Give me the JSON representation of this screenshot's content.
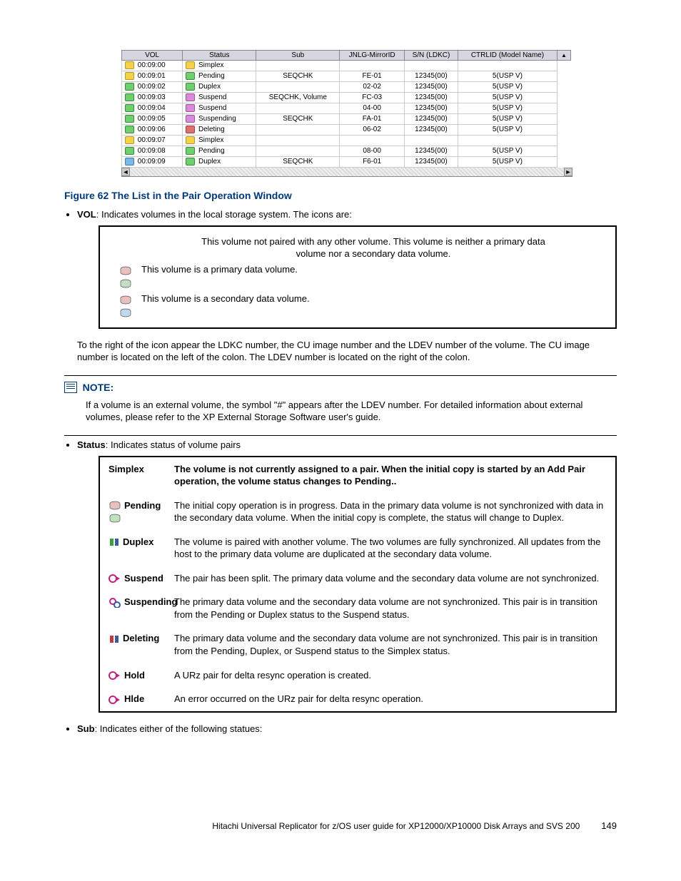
{
  "volTable": {
    "headers": [
      "VOL",
      "Status",
      "Sub",
      "JNLG-MirrorID",
      "S/N (LDKC)",
      "CTRLID (Model Name)"
    ],
    "rows": [
      {
        "iconA": "y",
        "vol": "00:09:00",
        "iconB": "y",
        "status": "Simplex",
        "sub": "",
        "mirror": "",
        "sn": "",
        "ctrl": ""
      },
      {
        "iconA": "y",
        "vol": "00:09:01",
        "iconB": "g",
        "status": "Pending",
        "sub": "SEQCHK",
        "mirror": "FE-01",
        "sn": "12345(00)",
        "ctrl": "5(USP V)"
      },
      {
        "iconA": "g",
        "vol": "00:09:02",
        "iconB": "g",
        "status": "Duplex",
        "sub": "",
        "mirror": "02-02",
        "sn": "12345(00)",
        "ctrl": "5(USP V)"
      },
      {
        "iconA": "g",
        "vol": "00:09:03",
        "iconB": "p",
        "status": "Suspend",
        "sub": "SEQCHK, Volume",
        "mirror": "FC-03",
        "sn": "12345(00)",
        "ctrl": "5(USP V)"
      },
      {
        "iconA": "g",
        "vol": "00:09:04",
        "iconB": "p",
        "status": "Suspend",
        "sub": "",
        "mirror": "04-00",
        "sn": "12345(00)",
        "ctrl": "5(USP V)"
      },
      {
        "iconA": "g",
        "vol": "00:09:05",
        "iconB": "p",
        "status": "Suspending",
        "sub": "SEQCHK",
        "mirror": "FA-01",
        "sn": "12345(00)",
        "ctrl": "5(USP V)"
      },
      {
        "iconA": "g",
        "vol": "00:09:06",
        "iconB": "r",
        "status": "Deleting",
        "sub": "",
        "mirror": "06-02",
        "sn": "12345(00)",
        "ctrl": "5(USP V)"
      },
      {
        "iconA": "y",
        "vol": "00:09:07",
        "iconB": "y",
        "status": "Simplex",
        "sub": "",
        "mirror": "",
        "sn": "",
        "ctrl": ""
      },
      {
        "iconA": "g",
        "vol": "00:09:08",
        "iconB": "g",
        "status": "Pending",
        "sub": "",
        "mirror": "08-00",
        "sn": "12345(00)",
        "ctrl": "5(USP V)"
      },
      {
        "iconA": "b",
        "vol": "00:09:09",
        "iconB": "g",
        "status": "Duplex",
        "sub": "SEQCHK",
        "mirror": "F6-01",
        "sn": "12345(00)",
        "ctrl": "5(USP V)"
      }
    ]
  },
  "figureCaption": "Figure 62 The List in the Pair Operation Window",
  "volBullet": {
    "label": "VOL",
    "text": ": Indicates volumes in the local storage system. The icons are:"
  },
  "iconDefs": [
    {
      "icon": "",
      "text": "This volume not paired with any other volume. This volume is neither a primary data volume nor a secondary data volume."
    },
    {
      "icon": "pri",
      "text": "This volume is a primary data volume."
    },
    {
      "icon": "sec",
      "text": "This volume is a secondary data volume."
    }
  ],
  "afterIconDefs": "To the right of the icon appear the LDKC number, the CU image number and the LDEV number of the volume. The CU image number is located on the left of the colon. The LDEV number is located on the right of the colon.",
  "noteHead": "NOTE:",
  "noteBody": "If a volume is an external volume, the symbol \"#\" appears after the LDEV number. For detailed information about external volumes, please refer to the XP External Storage Software user's guide.",
  "statusBullet": {
    "label": "Status",
    "text": ": Indicates status of volume pairs"
  },
  "statusDefs": [
    {
      "icon": "",
      "label": "Simplex",
      "desc": "The volume is not currently assigned to a pair. When the initial copy is started by an Add Pair operation, the volume status changes to Pending..",
      "head": true
    },
    {
      "icon": "pending",
      "label": "Pending",
      "desc": "The initial copy operation is in progress. Data in the primary data volume is not synchronized with data in the secondary data volume. When the initial copy is complete, the status will change to Duplex."
    },
    {
      "icon": "duplex",
      "label": "Duplex",
      "desc": "The volume is paired with another volume. The two volumes are fully synchronized. All updates from the host to the primary data volume are duplicated at the secondary data volume."
    },
    {
      "icon": "suspend",
      "label": "Suspend",
      "desc": "The pair has been split. The primary data volume and the secondary data volume are not synchronized."
    },
    {
      "icon": "suspending",
      "label": "Suspending",
      "desc": "The primary data volume and the secondary data volume are not synchronized. This pair is in transition from the Pending or Duplex status to the Suspend status."
    },
    {
      "icon": "deleting",
      "label": "Deleting",
      "desc": "The primary data volume and the secondary data volume are not synchronized. This pair is in transition from the Pending, Duplex, or Suspend status to the Simplex status."
    },
    {
      "icon": "hold",
      "label": "Hold",
      "desc": "A URz pair for delta resync operation is created."
    },
    {
      "icon": "hlde",
      "label": "Hlde",
      "desc": "An error occurred on the URz pair for delta resync operation."
    }
  ],
  "subBullet": {
    "label": "Sub",
    "text": ": Indicates either of the following statues:"
  },
  "footer": {
    "text": "Hitachi Universal Replicator for z/OS user guide for XP12000/XP10000 Disk Arrays and SVS 200",
    "page": "149"
  }
}
